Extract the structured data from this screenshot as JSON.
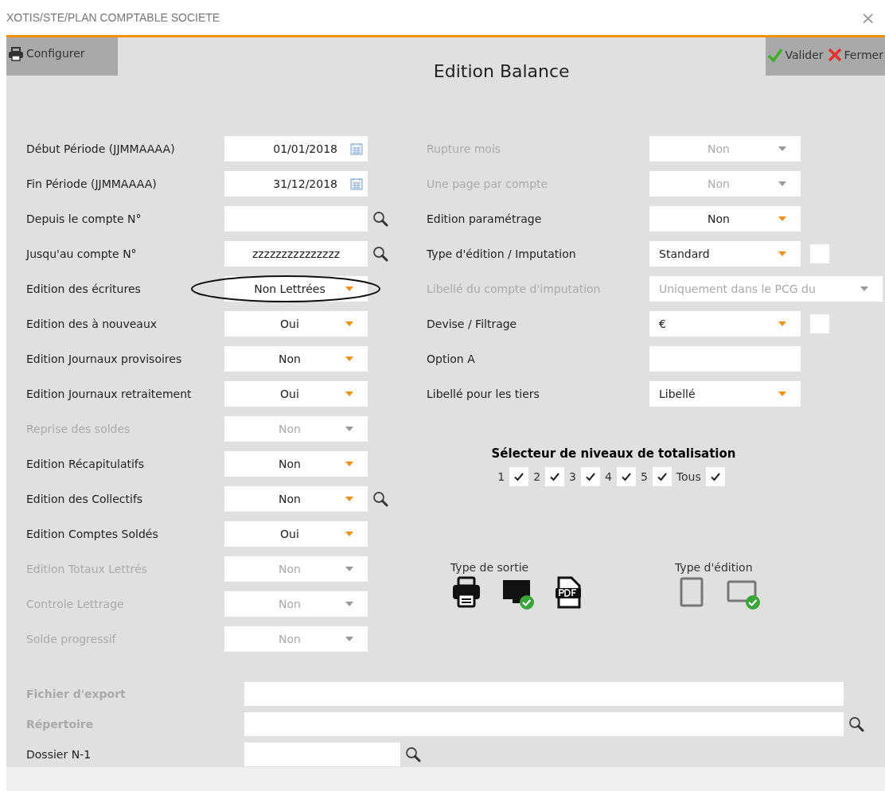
{
  "window": {
    "title": "XOTIS/STE/PLAN COMPTABLE SOCIETE",
    "close": "×"
  },
  "toolbar": {
    "left": [
      {
        "label": "Configurer",
        "kind": "printer"
      }
    ],
    "right": [
      {
        "label": "Valider",
        "kind": "ok"
      },
      {
        "label": "Fermer",
        "kind": "cancel"
      }
    ]
  },
  "heading": "Edition Balance",
  "left_fields": [
    {
      "label": "Début Période (JJMMAAAA)",
      "kind": "date",
      "value": "01/01/2018",
      "disabled": false
    },
    {
      "label": "Fin Période (JJMMAAAA)",
      "kind": "date",
      "value": "31/12/2018",
      "disabled": false
    },
    {
      "label": "Depuis le compte N°",
      "kind": "text",
      "disabled": false,
      "search_button": true
    },
    {
      "label": "Jusqu'au compte N°",
      "kind": "text",
      "value": "zzzzzzzzzzzzzzz",
      "disabled": false,
      "search_button": true
    },
    {
      "label": "Edition des écritures",
      "kind": "select",
      "value": "Non Lettrées",
      "disabled": false,
      "circled": true
    },
    {
      "label": "Edition des à nouveaux",
      "kind": "select",
      "value": "Oui",
      "disabled": false
    },
    {
      "label": "Edition Journaux provisoires",
      "kind": "select",
      "value": "Non",
      "disabled": false
    },
    {
      "label": "Edition Journaux retraitement",
      "kind": "select",
      "value": "Oui",
      "disabled": false
    },
    {
      "label": "Reprise des soldes",
      "kind": "select",
      "value": "Non",
      "disabled": true
    },
    {
      "label": "Edition Récapitulatifs",
      "kind": "select",
      "value": "Non",
      "disabled": false
    },
    {
      "label": "Edition des Collectifs",
      "kind": "select",
      "value": "Non",
      "disabled": false,
      "search_button": true
    },
    {
      "label": "Edition Comptes Soldés",
      "kind": "select",
      "value": "Oui",
      "disabled": false
    },
    {
      "label": "Edition Totaux Lettrés",
      "kind": "select",
      "value": "Non",
      "disabled": true
    },
    {
      "label": "Controle Lettrage",
      "kind": "select",
      "value": "Non",
      "disabled": true
    },
    {
      "label": "Solde progressif",
      "kind": "select",
      "value": "Non",
      "disabled": true
    }
  ],
  "right_fields": [
    {
      "label": "Rupture mois",
      "kind": "select",
      "value": "Non",
      "disabled": true
    },
    {
      "label": "Une page par compte",
      "kind": "select",
      "value": "Non",
      "disabled": true
    },
    {
      "label": "Edition paramétrage",
      "kind": "select",
      "value": "Non",
      "disabled": false
    },
    {
      "label": "Type d'édition / Imputation",
      "kind": "list-select",
      "value": "Standard",
      "disabled": false,
      "checkbox": {
        "checked": false
      }
    },
    {
      "label": "Libellé du compte d'imputation",
      "kind": "wide-select",
      "value": "Uniquement dans le PCG du",
      "disabled": true
    },
    {
      "label": "Devise / Filtrage",
      "kind": "list-select",
      "value": "€",
      "disabled": false,
      "checkbox": {
        "checked": false
      }
    },
    {
      "label": "Option A",
      "kind": "text",
      "disabled": false
    },
    {
      "label": "Libellé pour les tiers",
      "kind": "list-select",
      "value": "Libellé",
      "disabled": false
    }
  ],
  "levels": {
    "title": "Sélecteur de niveaux de totalisation",
    "items": [
      {
        "label": "1",
        "checked": true
      },
      {
        "label": "2",
        "checked": true
      },
      {
        "label": "3",
        "checked": true
      },
      {
        "label": "4",
        "checked": true
      },
      {
        "label": "5",
        "checked": true
      },
      {
        "label": "Tous",
        "checked": true
      }
    ]
  },
  "output_type": {
    "label": "Type de sortie",
    "options": [
      {
        "kind": "printer",
        "selected": false
      },
      {
        "kind": "screen",
        "selected": true
      },
      {
        "kind": "pdf",
        "selected": false
      }
    ]
  },
  "edition_type": {
    "label": "Type d'édition",
    "options": [
      {
        "kind": "portrait",
        "selected": false
      },
      {
        "kind": "landscape",
        "selected": true
      }
    ]
  },
  "bottom_fields": [
    {
      "label": "Fichier d'export",
      "kind": "long",
      "disabled": true
    },
    {
      "label": "Répertoire",
      "kind": "long",
      "disabled": true,
      "search_button": true
    },
    {
      "label": "Dossier N-1",
      "kind": "short",
      "disabled": false,
      "search_button": true
    }
  ]
}
